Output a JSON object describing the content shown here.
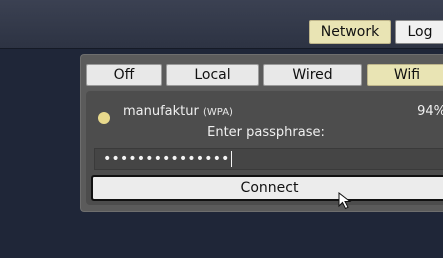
{
  "tabs": {
    "network": "Network",
    "log": "Log"
  },
  "modes": {
    "off": "Off",
    "local": "Local",
    "wired": "Wired",
    "wifi": "Wifi",
    "selected": "Wifi"
  },
  "network": {
    "ssid": "manufaktur",
    "security": "(WPA)",
    "signal": "94%",
    "status_color": "#e8d98c"
  },
  "passphrase": {
    "prompt": "Enter passphrase:",
    "masked_value": "•••••••••••••••"
  },
  "actions": {
    "connect": "Connect"
  },
  "colors": {
    "accent": "#e9e4b4",
    "background": "#1f2638"
  }
}
